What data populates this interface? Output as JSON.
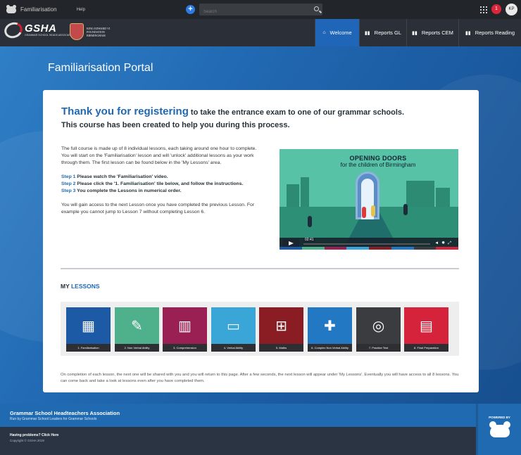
{
  "topbar": {
    "crumb": "Familiarisation",
    "help": "Help",
    "add_label": "+",
    "search_placeholder": "Search",
    "notification_count": "1",
    "user_initials": "KP"
  },
  "header": {
    "gsha_logo_text": "GSHA",
    "gsha_logo_subtext": "GRAMMAR SCHOOL HEADS ASSOCIATION",
    "kes_logo_line1": "KING EDWARD VI",
    "kes_logo_line2": "FOUNDATION",
    "kes_logo_line3": "BIRMINGHAM",
    "nav": [
      {
        "label": "Welcome",
        "icon": "home-icon",
        "active": true
      },
      {
        "label": "Reports GL",
        "icon": "bar-chart-icon",
        "active": false
      },
      {
        "label": "Reports CEM",
        "icon": "bar-chart-icon",
        "active": false
      },
      {
        "label": "Reports Reading",
        "icon": "bar-chart-icon",
        "active": false
      }
    ]
  },
  "page": {
    "title": "Familiarisation Portal"
  },
  "card": {
    "heading_highlight": "Thank you for registering",
    "heading_rest": " to take the entrance exam to one of our grammar schools.",
    "subheading": "This course has been created to help you during this process.",
    "intro": "The full course is made up of 8 individual lessons, each taking around one hour to complete. You will start on the 'Familiarisation' lesson and will 'unlock' additional lessons as your work through them.  The first lesson can be found below in the 'My Lessons' area.",
    "steps": [
      {
        "label": "Step 1",
        "text": " Please watch the 'Familiarisation' video."
      },
      {
        "label": "Step 2",
        "text": " Please click the '1. Familiarisation' tile below, and follow the instructions."
      },
      {
        "label": "Step 3",
        "text": " You complete the Lessons in numerical order."
      }
    ],
    "access_note": "You will gain access to the next Lesson once you have completed the previous Lesson. For example you cannot jump to Lesson 7 without completing Lesson 6.",
    "video": {
      "title_line1": "OPENING DOORS",
      "title_line2": "for the children of Birmingham",
      "time": "02:41"
    },
    "my_lessons_prefix": "MY ",
    "my_lessons_highlight": "LESSONS",
    "lessons": [
      {
        "label": "1. Familiarisation",
        "color": "#1c5aa6",
        "icon": "apps-icon"
      },
      {
        "label": "2. Non Verbal Ability",
        "color": "#4fb08c",
        "icon": "pencil-icon"
      },
      {
        "label": "3. Comprehension",
        "color": "#9a1f52",
        "icon": "books-icon"
      },
      {
        "label": "4. Verbal Ability",
        "color": "#3aa6d8",
        "icon": "speech-bubble-icon"
      },
      {
        "label": "5. Maths",
        "color": "#8a1c24",
        "icon": "calculator-icon"
      },
      {
        "label": "6. Complex Non Verbal Ability",
        "color": "#2278c2",
        "icon": "puzzle-icon"
      },
      {
        "label": "7. Practice Test",
        "color": "#3a3c40",
        "icon": "target-icon"
      },
      {
        "label": "8. Final Preparation",
        "color": "#d4233a",
        "icon": "clipboard-icon"
      }
    ],
    "completion_note": "On completion of each lesson, the next one will be shared with you and you will return to this page. After a few seconds, the next lesson will appear under 'My Lessons'. Eventually you will have access to all 8 lessons. You can come back and take a look at lessons even after you have completed them."
  },
  "footer": {
    "org": "Grammar School Headteachers Association",
    "tagline": "Run by Grammar School Leaders for Grammar Schools",
    "problems": "Having problems? Click Here",
    "copyright": "Copyright © GSHA 2019",
    "powered_by": "POWERED BY"
  }
}
